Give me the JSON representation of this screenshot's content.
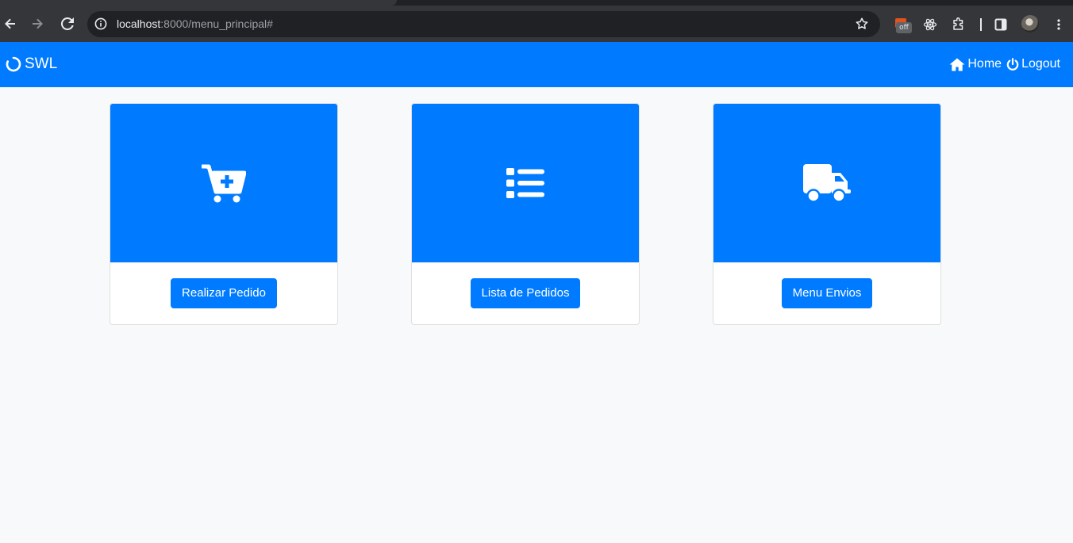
{
  "browser": {
    "url_host": "localhost",
    "url_path": ":8000/menu_principal#",
    "extension_badge": "off"
  },
  "navbar": {
    "brand": "SWL",
    "links": [
      {
        "label": "Home",
        "icon": "home-icon"
      },
      {
        "label": "Logout",
        "icon": "power-icon"
      }
    ]
  },
  "cards": [
    {
      "icon": "cart-plus-icon",
      "button": "Realizar Pedido"
    },
    {
      "icon": "list-icon",
      "button": "Lista de Pedidos"
    },
    {
      "icon": "truck-icon",
      "button": "Menu Envios"
    }
  ],
  "colors": {
    "primary": "#007bff",
    "page_background": "#f8f9fa",
    "browser_toolbar": "#35363a"
  }
}
